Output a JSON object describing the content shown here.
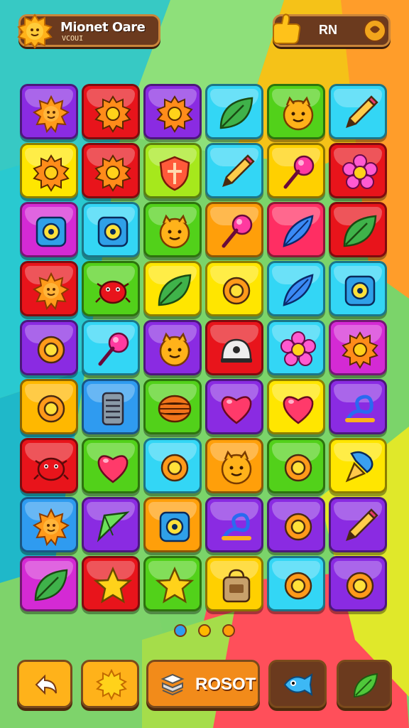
{
  "header": {
    "title": "Mionet Oare",
    "subtitle": "VCOUI",
    "currency_value": "RN",
    "sun_icon": "sun-icon",
    "hand_icon": "thumbs-up-hand-icon",
    "add_icon": "plus-icon"
  },
  "board": {
    "rows": 9,
    "cols": 6,
    "tiles": [
      [
        {
          "bg": "#8a2be2",
          "icon": "sun-icon"
        },
        {
          "bg": "#e8141b",
          "icon": "gear-icon"
        },
        {
          "bg": "#8a2be2",
          "icon": "gear-icon"
        },
        {
          "bg": "#33d6f5",
          "icon": "leaf-icon"
        },
        {
          "bg": "#52d11a",
          "icon": "face-icon"
        },
        {
          "bg": "#33d6f5",
          "icon": "pencil-icon"
        }
      ],
      [
        {
          "bg": "#ffe600",
          "icon": "gear-icon"
        },
        {
          "bg": "#e8141b",
          "icon": "gear-icon"
        },
        {
          "bg": "#a6e81c",
          "icon": "shield-icon"
        },
        {
          "bg": "#33d6f5",
          "icon": "pencil-icon"
        },
        {
          "bg": "#ffd000",
          "icon": "pin-icon"
        },
        {
          "bg": "#e8141b",
          "icon": "flower-icon"
        }
      ],
      [
        {
          "bg": "#d42ad4",
          "icon": "target-icon"
        },
        {
          "bg": "#33d6f5",
          "icon": "target-icon"
        },
        {
          "bg": "#52d11a",
          "icon": "face-icon"
        },
        {
          "bg": "#ff9f0a",
          "icon": "pin-icon"
        },
        {
          "bg": "#ff2e63",
          "icon": "feather-icon"
        },
        {
          "bg": "#e8141b",
          "icon": "leaf-icon"
        }
      ],
      [
        {
          "bg": "#e8141b",
          "icon": "sun-icon"
        },
        {
          "bg": "#52d11a",
          "icon": "bug-icon"
        },
        {
          "bg": "#ffe600",
          "icon": "leaf-icon"
        },
        {
          "bg": "#ffe600",
          "icon": "ring-icon"
        },
        {
          "bg": "#33d6f5",
          "icon": "feather-icon"
        },
        {
          "bg": "#33d6f5",
          "icon": "target-icon"
        }
      ],
      [
        {
          "bg": "#8a2be2",
          "icon": "ring-icon"
        },
        {
          "bg": "#33d6f5",
          "icon": "pin-icon"
        },
        {
          "bg": "#8a2be2",
          "icon": "face-icon"
        },
        {
          "bg": "#e8141b",
          "icon": "dome-icon"
        },
        {
          "bg": "#33d6f5",
          "icon": "flower-icon"
        },
        {
          "bg": "#d42ad4",
          "icon": "gear-icon"
        }
      ],
      [
        {
          "bg": "#ffb800",
          "icon": "ring-icon"
        },
        {
          "bg": "#2f9bf0",
          "icon": "stack-icon"
        },
        {
          "bg": "#52d11a",
          "icon": "ball-icon"
        },
        {
          "bg": "#8a2be2",
          "icon": "heart-icon"
        },
        {
          "bg": "#ffe600",
          "icon": "heart-icon"
        },
        {
          "bg": "#8a2be2",
          "icon": "knot-icon"
        }
      ],
      [
        {
          "bg": "#e8141b",
          "icon": "bug-icon"
        },
        {
          "bg": "#52d11a",
          "icon": "heart-icon"
        },
        {
          "bg": "#33d6f5",
          "icon": "ring-icon"
        },
        {
          "bg": "#ff9f0a",
          "icon": "face-icon"
        },
        {
          "bg": "#52d11a",
          "icon": "ring-icon"
        },
        {
          "bg": "#ffe600",
          "icon": "popsicle-icon"
        }
      ],
      [
        {
          "bg": "#2f9bf0",
          "icon": "sun-icon"
        },
        {
          "bg": "#8a2be2",
          "icon": "arrow-icon"
        },
        {
          "bg": "#ff9f0a",
          "icon": "target-icon"
        },
        {
          "bg": "#8a2be2",
          "icon": "knot-icon"
        },
        {
          "bg": "#8a2be2",
          "icon": "ring-icon"
        },
        {
          "bg": "#8a2be2",
          "icon": "pencil-icon"
        }
      ],
      [
        {
          "bg": "#d42ad4",
          "icon": "leaf-icon"
        },
        {
          "bg": "#e8141b",
          "icon": "star-icon"
        },
        {
          "bg": "#52d11a",
          "icon": "star-icon"
        },
        {
          "bg": "#ffd000",
          "icon": "bag-icon"
        },
        {
          "bg": "#33d6f5",
          "icon": "ring-icon"
        },
        {
          "bg": "#8a2be2",
          "icon": "ring-icon"
        }
      ]
    ]
  },
  "pager": [
    {
      "color": "#2f9bf0",
      "active": true
    },
    {
      "color": "#ffb800",
      "active": false
    },
    {
      "color": "#ff9f0a",
      "active": false
    }
  ],
  "footer": {
    "back_icon": "back-arrow-icon",
    "sun_icon": "sun-icon",
    "robot_icon": "stack-icon",
    "robot_label": "ROSOT",
    "fish_icon": "fish-icon",
    "leaf_icon": "leaf-icon"
  }
}
